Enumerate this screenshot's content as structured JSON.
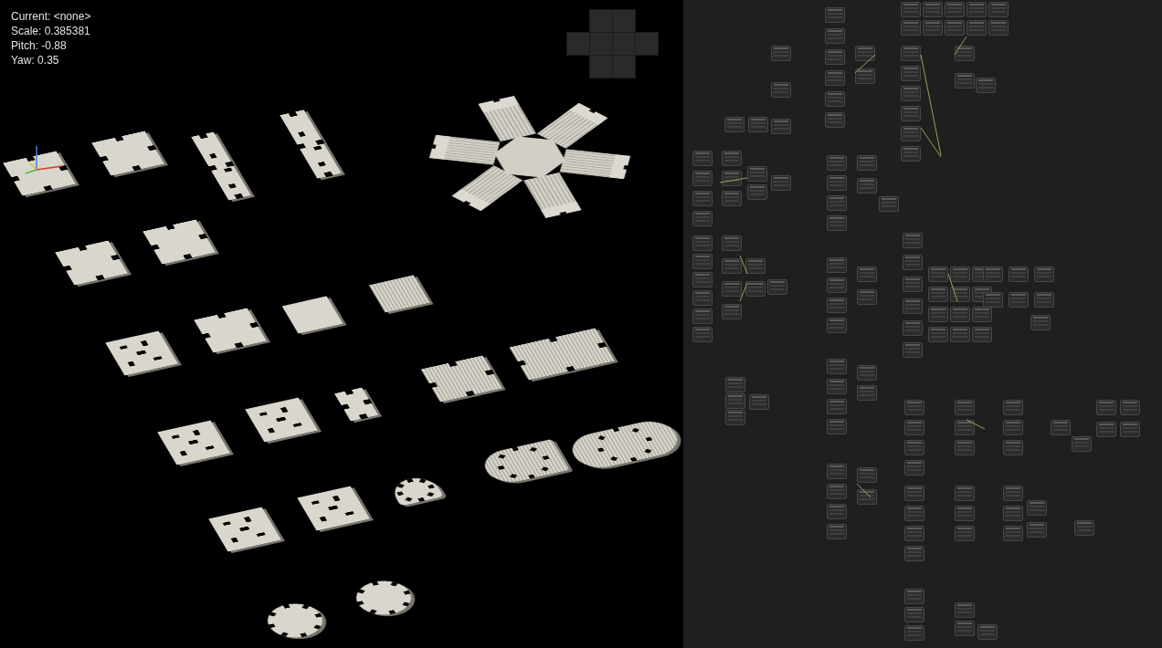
{
  "hud": [
    "Current: <none>",
    "Scale: 0.385381",
    "Pitch: -0.88",
    "Yaw: 0.35"
  ],
  "tiles": [
    {
      "kind": "notched",
      "textured": false
    },
    {
      "kind": "notched",
      "textured": false
    },
    {
      "kind": "strip",
      "textured": false
    },
    {
      "kind": "strip",
      "textured": false
    },
    {
      "kind": "hex",
      "textured": true
    },
    {
      "kind": "notched",
      "textured": false
    },
    {
      "kind": "notched",
      "textured": false
    },
    {
      "kind": "cutout",
      "textured": false
    },
    {
      "kind": "notched",
      "textured": false
    },
    {
      "kind": "plain",
      "textured": false
    },
    {
      "kind": "plain",
      "textured": true
    },
    {
      "kind": "notched",
      "textured": true
    },
    {
      "kind": "notched",
      "textured": true
    },
    {
      "kind": "cutout",
      "textured": false
    },
    {
      "kind": "cutout",
      "textured": false
    },
    {
      "kind": "notched",
      "textured": false
    },
    {
      "kind": "rounded",
      "textured": true
    },
    {
      "kind": "oval",
      "textured": true
    },
    {
      "kind": "half-disc",
      "textured": false
    },
    {
      "kind": "cutout",
      "textured": false
    },
    {
      "kind": "cutout",
      "textured": false
    },
    {
      "kind": "disc",
      "textured": false
    },
    {
      "kind": "disc",
      "textured": false
    }
  ]
}
